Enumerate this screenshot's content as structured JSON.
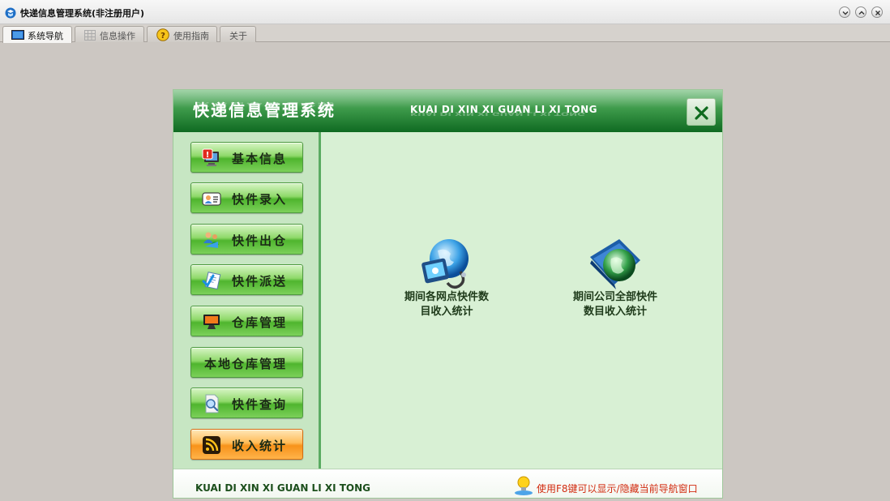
{
  "window": {
    "title": "快递信息管理系统(非注册用户)"
  },
  "tabs": [
    {
      "label": "系统导航",
      "icon": "monitor-icon"
    },
    {
      "label": "信息操作",
      "icon": "grid-icon"
    },
    {
      "label": "使用指南",
      "icon": "help-icon"
    },
    {
      "label": "关于",
      "icon": ""
    }
  ],
  "header": {
    "title": "快递信息管理系统",
    "subtitle": "KUAI DI XIN XI GUAN LI XI TONG"
  },
  "nav": [
    {
      "label": "基本信息",
      "icon": "info-monitor-icon"
    },
    {
      "label": "快件录入",
      "icon": "contact-card-icon"
    },
    {
      "label": "快件出仓",
      "icon": "users-shipping-icon"
    },
    {
      "label": "快件派送",
      "icon": "delivery-check-icon"
    },
    {
      "label": "仓库管理",
      "icon": "warehouse-monitor-icon"
    },
    {
      "label": "本地仓库管理",
      "icon": ""
    },
    {
      "label": "快件查询",
      "icon": "search-document-icon"
    },
    {
      "label": "收入统计",
      "icon": "rss-icon"
    }
  ],
  "main": {
    "items": [
      {
        "label_line1": "期间各网点快件数",
        "label_line2": "目收入统计",
        "icon": "network-globe-icon"
      },
      {
        "label_line1": "期间公司全部快件",
        "label_line2": "数目收入统计",
        "icon": "globe-book-icon"
      }
    ]
  },
  "footer": {
    "brand": "KUAI DI XIN XI GUAN LI XI TONG",
    "hint": "使用F8键可以显示/隐藏当前导航窗口"
  },
  "colors": {
    "header_dark": "#0f6a22",
    "panel_bg": "#d8f0d4",
    "hint_red": "#d22c10",
    "active_orange": "#f7921a"
  }
}
